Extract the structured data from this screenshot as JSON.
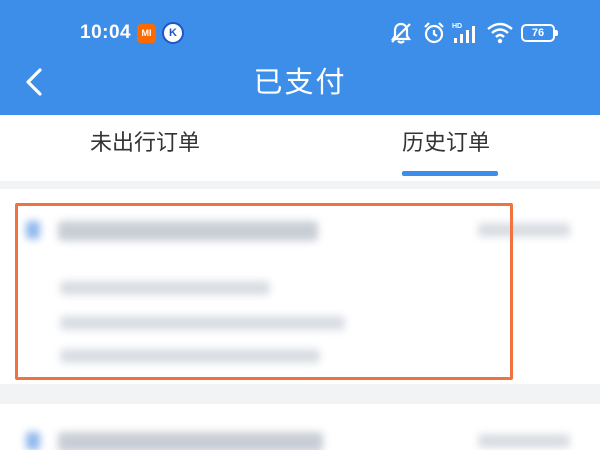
{
  "status_bar": {
    "time": "10:04",
    "mi_badge": "MI",
    "k_badge": "K",
    "battery": "76",
    "icons": [
      "mute-bell-icon",
      "alarm-icon",
      "hd-signal-icon",
      "wifi-icon",
      "battery-icon"
    ]
  },
  "header": {
    "title": "已支付",
    "back_icon": "chevron-left-icon"
  },
  "tabs": [
    {
      "label": "未出行订单",
      "active": false
    },
    {
      "label": "历史订单",
      "active": true
    }
  ],
  "colors": {
    "header_blue": "#3d8ee8",
    "highlight_orange": "#f27140",
    "background": "#f2f3f5"
  }
}
